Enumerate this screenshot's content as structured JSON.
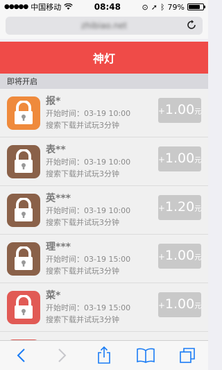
{
  "status_bar": {
    "carrier": "中国移动",
    "time": "08:48",
    "battery": "79%",
    "battery_level": 0.79
  },
  "browser": {
    "url": "zhibiao.net"
  },
  "header": {
    "title": "神灯"
  },
  "section": {
    "title": "即将开启"
  },
  "items": [
    {
      "name": "报*",
      "start_label": "开始时间：",
      "start_time": "03-19 10:00",
      "desc": "搜索下载并试玩3分钟",
      "plus": "+",
      "amount": "1.00",
      "unit": "元",
      "icon_color": "#ef8a3c"
    },
    {
      "name": "表**",
      "start_label": "开始时间：",
      "start_time": "03-19 10:00",
      "desc": "搜索下载并试玩3分钟",
      "plus": "+",
      "amount": "1.00",
      "unit": "元",
      "icon_color": "#8a6149"
    },
    {
      "name": "英***",
      "start_label": "开始时间：",
      "start_time": "03-19 10:00",
      "desc": "搜索下载并试玩3分钟",
      "plus": "+",
      "amount": "1.20",
      "unit": "元",
      "icon_color": "#8a6149"
    },
    {
      "name": "理***",
      "start_label": "开始时间：",
      "start_time": "03-19 15:00",
      "desc": "搜索下载并试玩3分钟",
      "plus": "+",
      "amount": "1.00",
      "unit": "元",
      "icon_color": "#8a6149"
    },
    {
      "name": "菜*",
      "start_label": "开始时间：",
      "start_time": "03-19 15:00",
      "desc": "搜索下载并试玩3分钟",
      "plus": "+",
      "amount": "1.00",
      "unit": "元",
      "icon_color": "#e15a55"
    },
    {
      "name": "",
      "start_label": "",
      "start_time": "",
      "desc": "",
      "plus": "",
      "amount": "",
      "unit": "",
      "icon_color": "#e15a55"
    }
  ],
  "toolbar": {
    "icons": [
      "back-icon",
      "forward-icon",
      "share-icon",
      "bookmarks-icon",
      "tabs-icon"
    ]
  },
  "colors": {
    "header": "#ef4b48",
    "reward_bg": "#c9c9c9",
    "ios_blue": "#1a7cf5"
  }
}
